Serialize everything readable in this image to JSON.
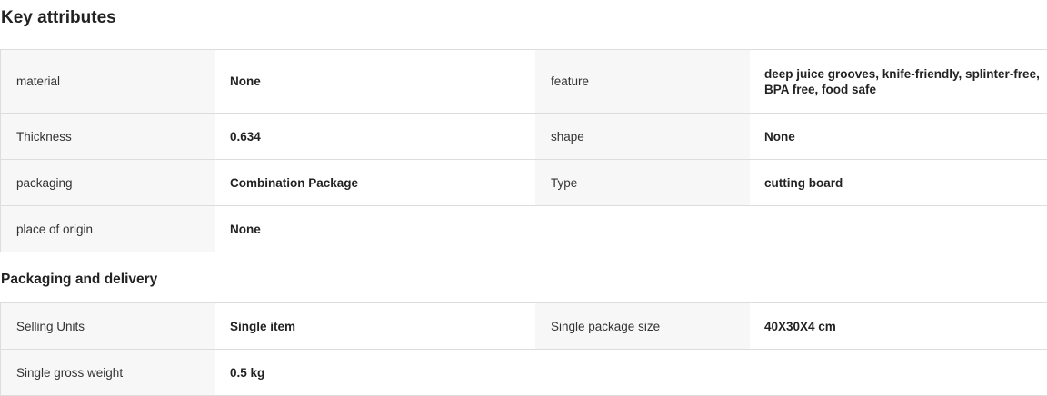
{
  "key_attributes": {
    "title": "Key attributes",
    "rows": [
      [
        {
          "label": "material",
          "value": "None"
        },
        {
          "label": "feature",
          "value": "deep juice grooves, knife-friendly, splinter-free, BPA free, food safe"
        }
      ],
      [
        {
          "label": "Thickness",
          "value": "0.634"
        },
        {
          "label": "shape",
          "value": "None"
        }
      ],
      [
        {
          "label": "packaging",
          "value": "Combination Package"
        },
        {
          "label": "Type",
          "value": "cutting board"
        }
      ],
      [
        {
          "label": "place of origin",
          "value": "None"
        }
      ]
    ]
  },
  "packaging_delivery": {
    "title": "Packaging and delivery",
    "rows": [
      [
        {
          "label": "Selling Units",
          "value": "Single item"
        },
        {
          "label": "Single package size",
          "value": "40X30X4 cm"
        }
      ],
      [
        {
          "label": "Single gross weight",
          "value": "0.5 kg"
        }
      ]
    ]
  }
}
